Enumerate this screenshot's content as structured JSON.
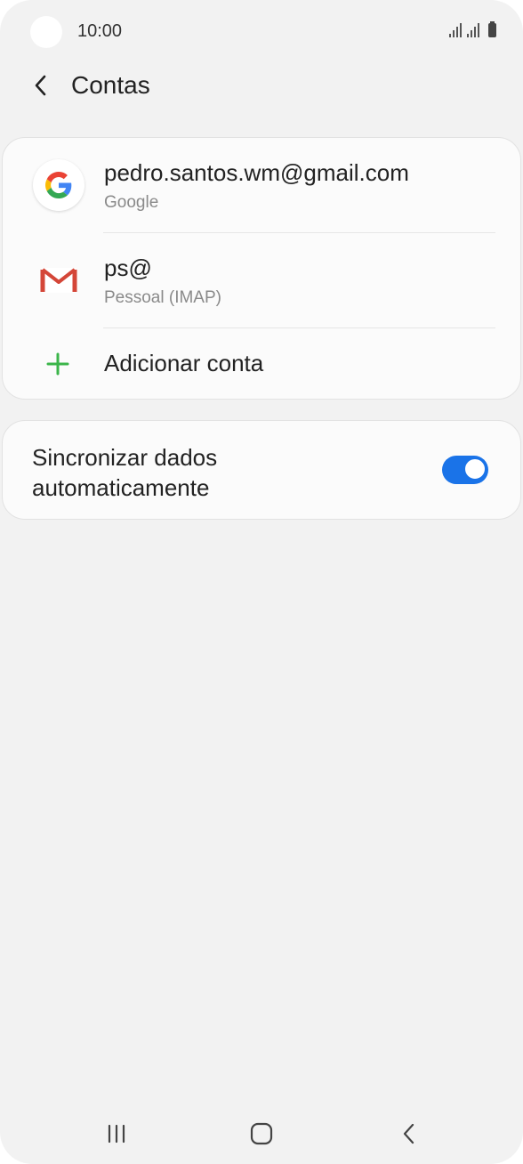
{
  "status_bar": {
    "time": "10:00"
  },
  "header": {
    "title": "Contas",
    "back_icon": "chevron-left-icon"
  },
  "accounts": [
    {
      "title": "pedro.santos.wm@gmail.com",
      "subtitle": "Google",
      "icon": "google-icon"
    },
    {
      "title": "ps@",
      "subtitle": "Pessoal (IMAP)",
      "icon": "gmail-icon"
    }
  ],
  "add_account": {
    "label": "Adicionar conta",
    "icon": "plus-icon",
    "icon_color": "#3bb54a"
  },
  "sync": {
    "label": "Sincronizar dados automaticamente",
    "enabled": true,
    "toggle_color": "#1a73e8"
  },
  "nav_bar": {
    "recents_icon": "recents-icon",
    "home_icon": "home-icon",
    "back_icon": "back-icon"
  }
}
